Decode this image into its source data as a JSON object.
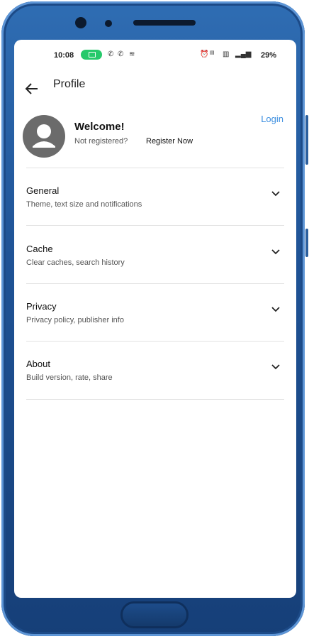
{
  "status_bar": {
    "time": "10:08",
    "battery": "29%"
  },
  "app_bar": {
    "title": "Profile"
  },
  "profile": {
    "welcome": "Welcome!",
    "not_registered": "Not registered?",
    "register_now": "Register Now",
    "login": "Login"
  },
  "settings": [
    {
      "title": "General",
      "subtitle": "Theme, text size and notifications"
    },
    {
      "title": "Cache",
      "subtitle": "Clear caches, search history"
    },
    {
      "title": "Privacy",
      "subtitle": "Privacy policy, publisher info"
    },
    {
      "title": "About",
      "subtitle": "Build version, rate, share"
    }
  ],
  "colors": {
    "accent": "#3d8fe0",
    "frame": "#1f5396",
    "avatar_bg": "#6b6b6b"
  }
}
